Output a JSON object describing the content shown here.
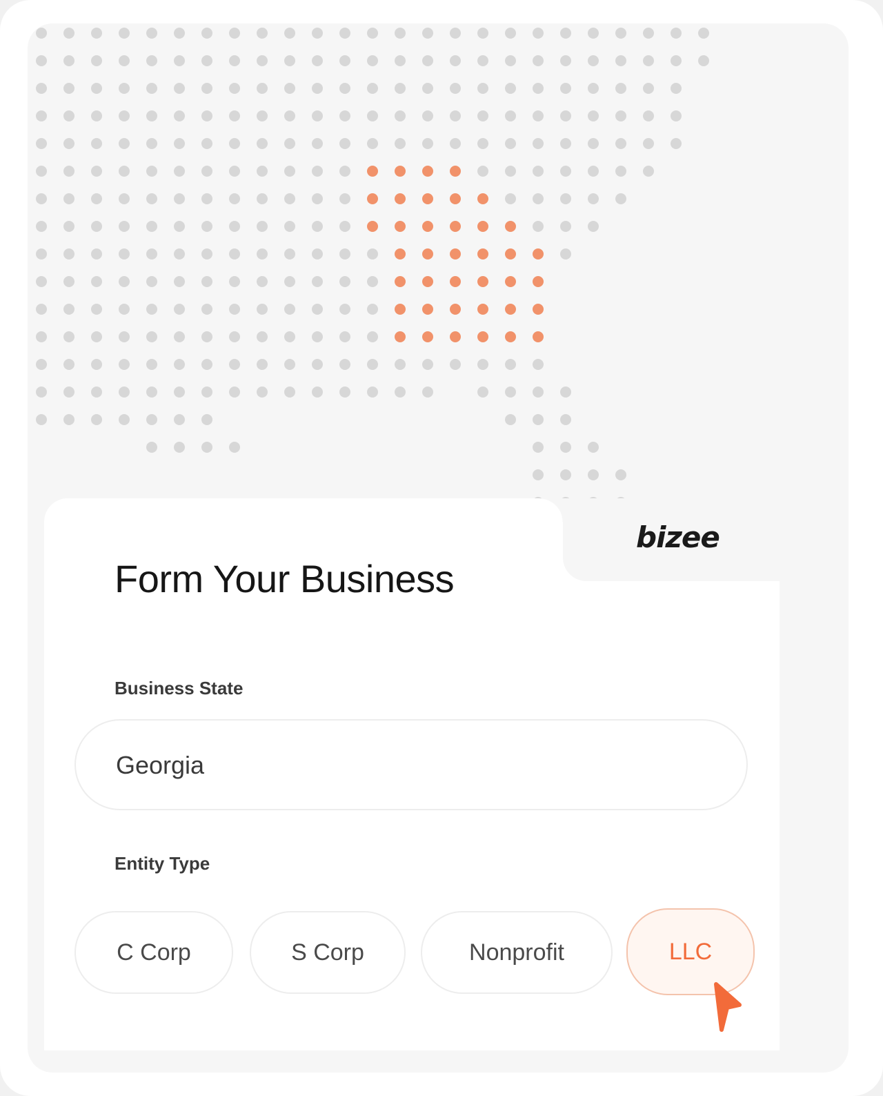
{
  "colors": {
    "accent": "#f26b3a",
    "dot_inactive": "#d7d7d7",
    "dot_active": "#f1926a",
    "panel_bg": "#f6f6f6",
    "card_bg": "#ffffff"
  },
  "brand": {
    "logo_text": "bizee"
  },
  "form": {
    "title": "Form Your Business",
    "business_state": {
      "label": "Business State",
      "value": "Georgia"
    },
    "entity_type": {
      "label": "Entity Type",
      "options": [
        "C Corp",
        "S Corp",
        "Nonprofit",
        "LLC"
      ],
      "selected": "LLC"
    }
  },
  "map": {
    "highlighted_region": "Georgia"
  },
  "icons": {
    "cursor": "pointer-arrow-icon"
  }
}
